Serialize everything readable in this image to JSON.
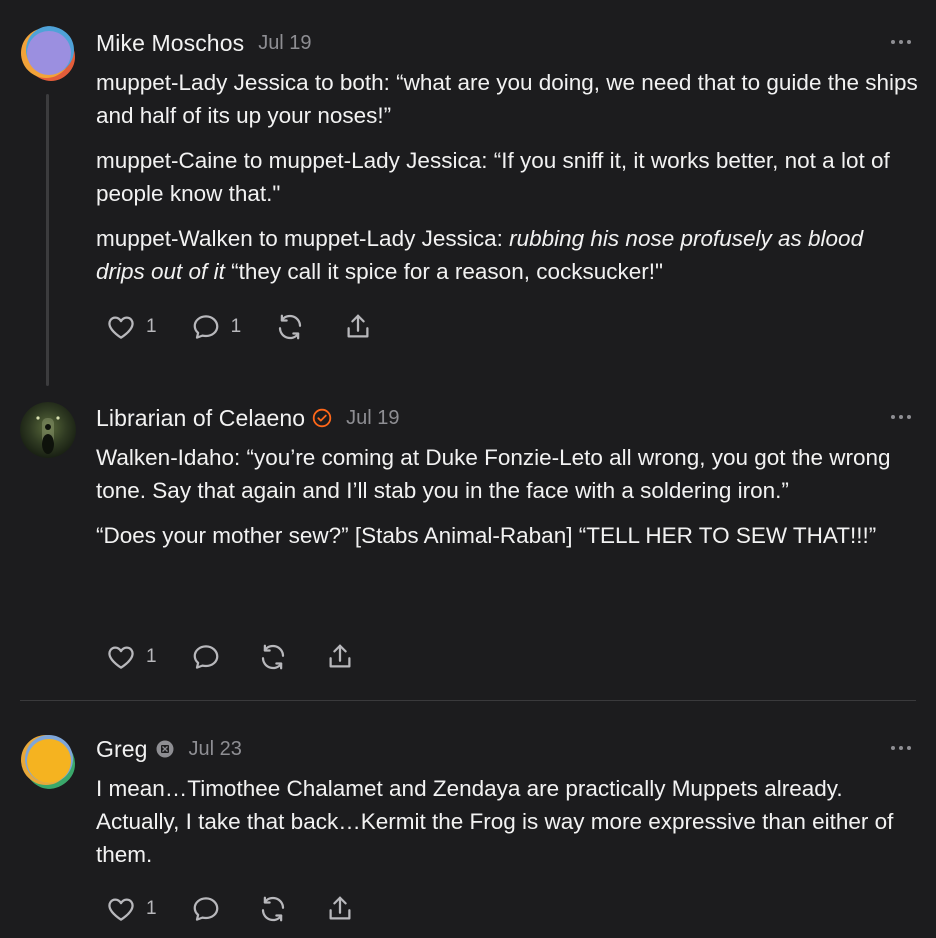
{
  "posts": [
    {
      "author": "Mike Moschos",
      "date": "Jul 19",
      "avatar_colors": [
        "#f2a33a",
        "#4fa2d8",
        "#9b8fe0"
      ],
      "paragraphs": [
        "muppet-Lady Jessica to both: “what are you doing, we need that to guide the ships and half of its up your noses!”",
        "muppet-Caine to muppet-Lady Jessica: “If you sniff it, it works better, not a lot of people know that.\"",
        "rubbing his nose profusely as blood drips out of it"
      ],
      "p3_prefix": "muppet-Walken to muppet-Lady Jessica: ",
      "p3_suffix": " “they call it spice for a reason, cocksucker!\"",
      "like_count": "1",
      "comment_count": "1"
    },
    {
      "author": "Librarian of Celaeno",
      "date": "Jul 19",
      "badge_icon": "verified-badge-icon",
      "accent": "#ff6719",
      "paragraphs": [
        "Walken-Idaho: “you’re coming at Duke Fonzie-Leto all wrong, you got the wrong tone. Say that again and I’ll stab you in the face with a soldering iron.”",
        "“Does your mother sew?” [Stabs Animal-Raban] “TELL HER TO SEW THAT!!!”"
      ],
      "like_count": "1"
    },
    {
      "author": "Greg",
      "date": "Jul 23",
      "badge_icon": "subscriber-badge-icon",
      "avatar_colors": [
        "#f5b320",
        "#3aa86b",
        "#e8a83a"
      ],
      "paragraphs": [
        "I mean…Timothee Chalamet and Zendaya are practically Muppets already. Actually, I take that back…Kermit the Frog is way more expressive than either of them."
      ],
      "like_count": "1"
    }
  ]
}
